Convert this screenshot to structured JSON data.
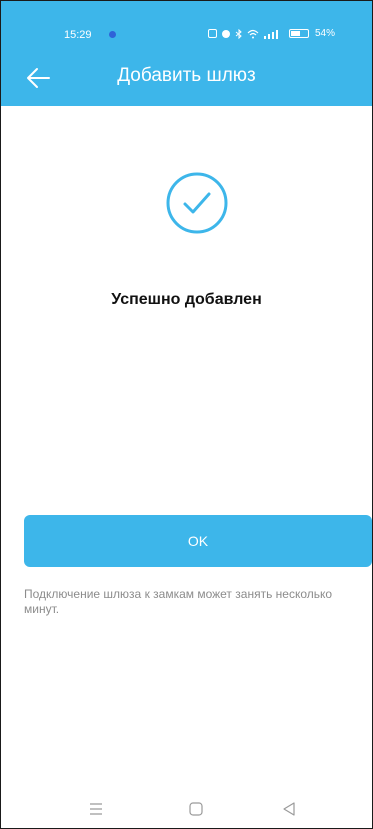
{
  "status_bar": {
    "time": "15:29",
    "battery": "54%"
  },
  "header": {
    "title": "Добавить шлюз"
  },
  "main": {
    "success_text": "Успешно добавлен",
    "ok_label": "OK",
    "note": "Подключение шлюза к замкам может занять несколько минут."
  },
  "icons": {
    "back": "arrow-left-icon",
    "success": "check-circle-icon",
    "nav_menu": "menu-icon",
    "nav_home": "square-home-icon",
    "nav_back": "triangle-back-icon"
  },
  "colors": {
    "accent": "#3db6ea",
    "text": "#111111",
    "note": "#8c8c8c"
  },
  "battery_level": 0.54
}
